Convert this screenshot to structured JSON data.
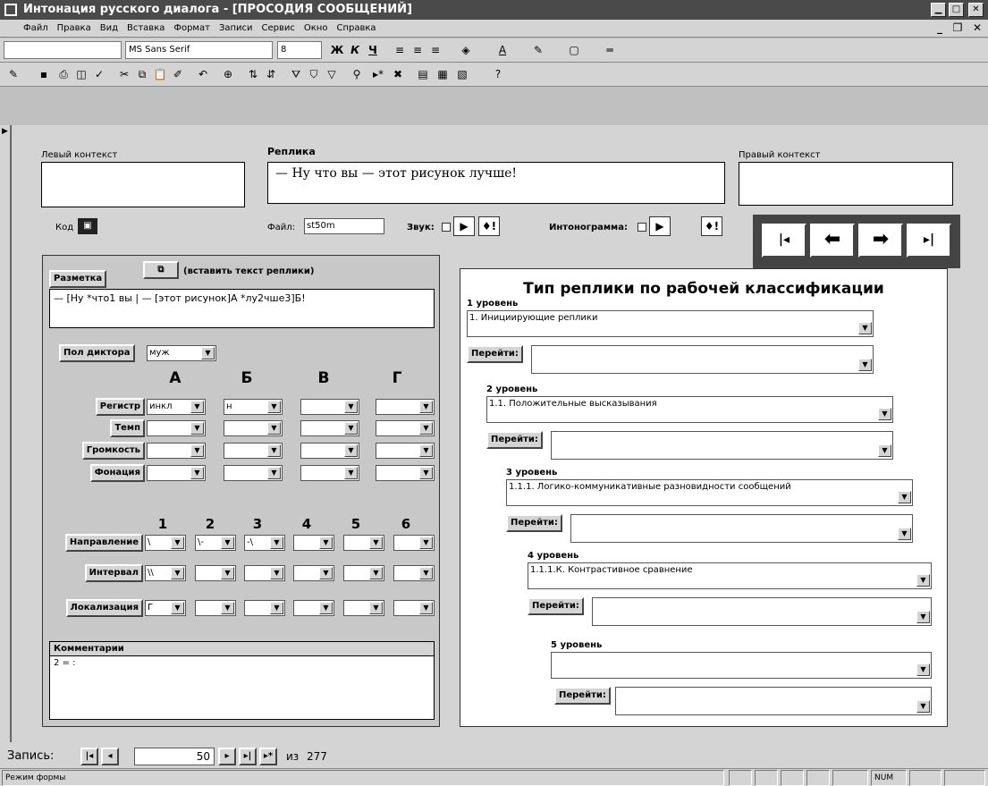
{
  "window": {
    "title": "Интонация русского диалога - [ПРОСОДИЯ СООБЩЕНИЙ]"
  },
  "menu": [
    "Файл",
    "Правка",
    "Вид",
    "Вставка",
    "Формат",
    "Записи",
    "Сервис",
    "Окно",
    "Справка"
  ],
  "toolbar": {
    "font": "MS Sans Serif",
    "size": "8"
  },
  "fields": {
    "left_context_label": "Левый контекст",
    "replica_label": "Реплика",
    "replica_text": "— Ну что вы — этот рисунок лучше!",
    "right_context_label": "Правый контекст",
    "code_label": "Код",
    "file_label": "Файл:",
    "file_value": "st50m",
    "sound_label": "Звук:",
    "intonogram_label": "Интонограмма:"
  },
  "markup": {
    "label": "Разметка",
    "paste_label": "(вставить текст реплики)",
    "text": "— [Ну *что1 вы | — [этот рисунок]А *лу2чше3]Б!",
    "speaker_label": "Пол диктора",
    "speaker_value": "муж",
    "col_headers": [
      "А",
      "Б",
      "В",
      "Г"
    ],
    "rows": [
      {
        "label": "Регистр",
        "values": [
          "инкл",
          "н",
          "",
          ""
        ]
      },
      {
        "label": "Темп",
        "values": [
          "",
          "",
          "",
          ""
        ]
      },
      {
        "label": "Громкость",
        "values": [
          "",
          "",
          "",
          ""
        ]
      },
      {
        "label": "Фонация",
        "values": [
          "",
          "",
          "",
          ""
        ]
      }
    ],
    "num_headers": [
      "1",
      "2",
      "3",
      "4",
      "5",
      "6"
    ],
    "num_rows": [
      {
        "label": "Направление",
        "values": [
          "\\",
          "\\-",
          "-\\",
          "",
          "",
          ""
        ]
      },
      {
        "label": "Интервал",
        "values": [
          "\\\\",
          "",
          "",
          "",
          "",
          ""
        ]
      },
      {
        "label": "Локализация",
        "values": [
          "Г",
          "",
          "",
          "",
          "",
          ""
        ]
      }
    ],
    "comments_label": "Комментарии",
    "comments_value": "2 = :"
  },
  "classification": {
    "title": "Тип реплики по рабочей классификации",
    "goto_label": "Перейти:",
    "levels": [
      {
        "label": "1 уровень",
        "value": "1. Инициирующие реплики"
      },
      {
        "label": "2 уровень",
        "value": "1.1. Положительные высказывания"
      },
      {
        "label": "3 уровень",
        "value": "1.1.1. Логико-коммуникативные разновидности сообщений"
      },
      {
        "label": "4 уровень",
        "value": "1.1.1.К. Контрастивное сравнение"
      },
      {
        "label": "5 уровень",
        "value": ""
      }
    ]
  },
  "record": {
    "label": "Запись:",
    "current": "50",
    "of_label": "из",
    "total": "277"
  },
  "status": {
    "mode": "Режим формы",
    "num": "NUM"
  }
}
